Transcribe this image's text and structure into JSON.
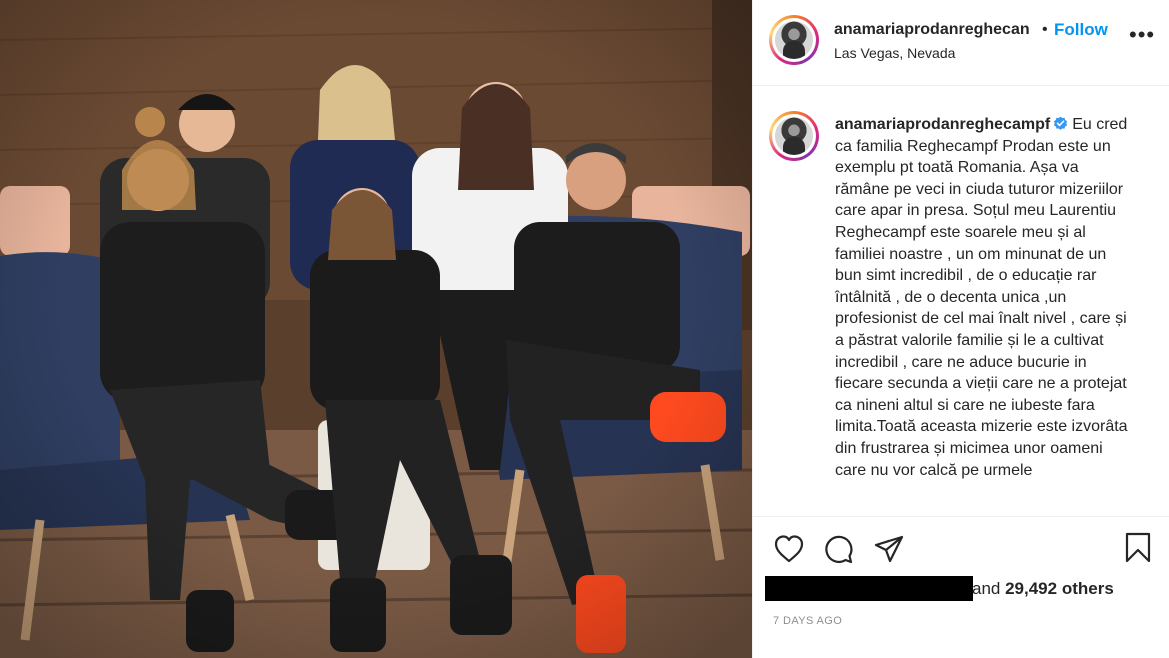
{
  "post": {
    "username": "anamariaprodanreghecan",
    "follow_label": "Follow",
    "separator": "•",
    "location": "Las Vegas, Nevada",
    "more_label": "•••"
  },
  "caption": {
    "username": "anamariaprodanreghecampf",
    "text": "Eu cred ca familia Reghecampf Prodan este un exemplu pt toată Romania. Așa va rămâne pe veci in ciuda tuturor mizeriilor care apar in presa. Soțul meu Laurentiu Reghecampf este soarele meu și al familiei noastre , un om minunat de un bun simt incredibil , de o educație rar întâlnită , de o decenta unica ,un profesionist de cel mai înalt nivel , care și a păstrat valorile familie și le a cultivat incredibil , care ne aduce bucurie in fiecare secunda a vieții care ne a protejat ca nineni altul si care ne iubeste fara limita.Toată aceasta mizerie este izvorâta din frustrarea și micimea unor oameni care nu vor calcă pe urmele"
  },
  "likes": {
    "and_text": "and ",
    "count": "29,492 others"
  },
  "time_ago": "7 DAYS AGO",
  "colors": {
    "link_blue": "#0095f6",
    "verified_blue": "#3897f0",
    "text": "#262626",
    "muted": "#8e8e8e",
    "border": "#efefef"
  },
  "icons": [
    "heart-icon",
    "comment-icon",
    "share-icon",
    "bookmark-icon",
    "verified-badge-icon",
    "more-options-icon"
  ]
}
